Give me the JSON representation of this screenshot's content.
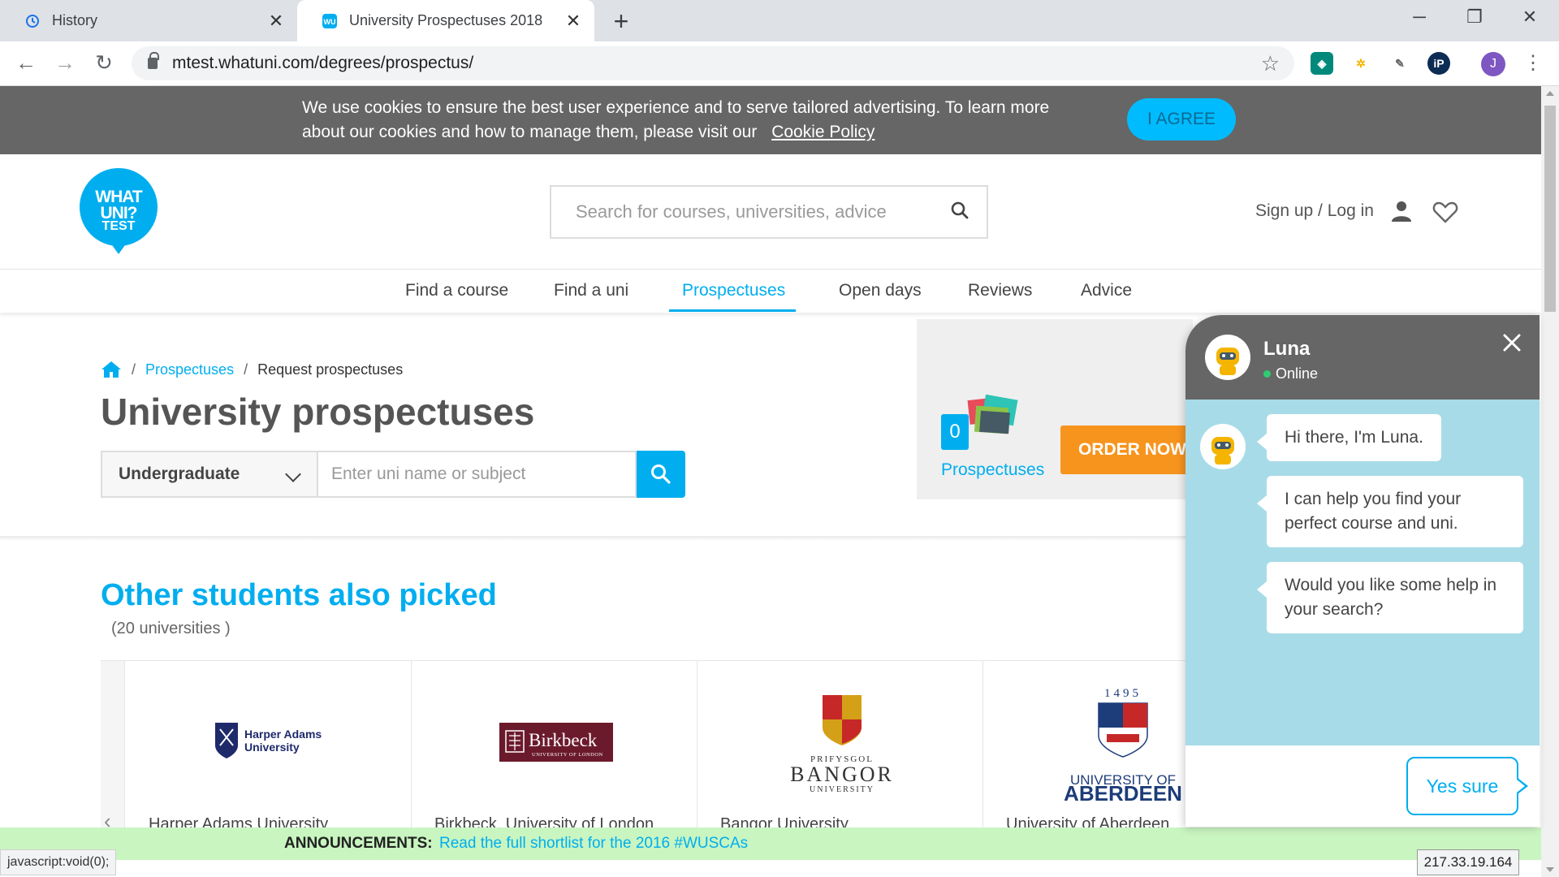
{
  "browser": {
    "tabs": [
      {
        "title": "History",
        "icon": "history-icon",
        "active": false
      },
      {
        "title": "University Prospectuses 2018",
        "icon": "whatuni-favicon-icon",
        "active": true
      }
    ],
    "new_tab": "+",
    "url": "mtest.whatuni.com/degrees/prospectus/",
    "profile_initial": "J",
    "ext_ip_label": "iP"
  },
  "cookie_banner": {
    "text": "We use cookies to ensure the best user experience and to serve tailored advertising. To learn more about our cookies and how to manage them, please visit our",
    "link": "Cookie Policy",
    "button": "I AGREE"
  },
  "header": {
    "logo_line1": "WHAT UNI?",
    "logo_line2": "TEST",
    "search_placeholder": "Search for courses, universities, advice",
    "signup_label": "Sign up / Log in"
  },
  "nav": {
    "items": [
      "Find a course",
      "Find a uni",
      "Prospectuses",
      "Open days",
      "Reviews",
      "Advice"
    ],
    "active": "Prospectuses"
  },
  "breadcrumb": {
    "sep": "/",
    "link": "Prospectuses",
    "current": "Request prospectuses"
  },
  "page_title": "University prospectuses",
  "filter": {
    "study_level": "Undergraduate",
    "input_placeholder": "Enter uni name or subject"
  },
  "order_panel": {
    "count": "0",
    "label": "Prospectuses",
    "button": "ORDER NOW"
  },
  "recommendations": {
    "title": "Other students also picked",
    "subtitle": "(20 universities )",
    "universities": [
      {
        "name": "Harper Adams University",
        "logo_text": "Harper Adams University"
      },
      {
        "name": "Birkbeck, University of London",
        "logo_text": "Birkbeck",
        "logo_sub": "UNIVERSITY OF LONDON"
      },
      {
        "name": "Bangor University",
        "logo_top": "PRIFYSGOL",
        "logo_text": "BANGOR",
        "logo_sub": "UNIVERSITY"
      },
      {
        "name": "University of Aberdeen",
        "logo_top": "1495",
        "logo_text": "UNIVERSITY OF",
        "logo_sub": "ABERDEEN"
      }
    ]
  },
  "announcement": {
    "label": "ANNOUNCEMENTS:",
    "link": "Read the full shortlist for the 2016 #WUSCAs"
  },
  "status_bar": "javascript:void(0);",
  "ip_address": "217.33.19.164",
  "chat": {
    "name": "Luna",
    "status": "Online",
    "messages": [
      "Hi there, I'm Luna.",
      "I can help you find your perfect course and uni.",
      "Would you like some help in your search?"
    ],
    "reply": "Yes sure"
  },
  "colors": {
    "brand": "#00aeef",
    "order": "#f7941d",
    "cookie_bg": "#666666",
    "announce_bg": "#c9f5c0",
    "chat_body": "#a8dbe8"
  }
}
